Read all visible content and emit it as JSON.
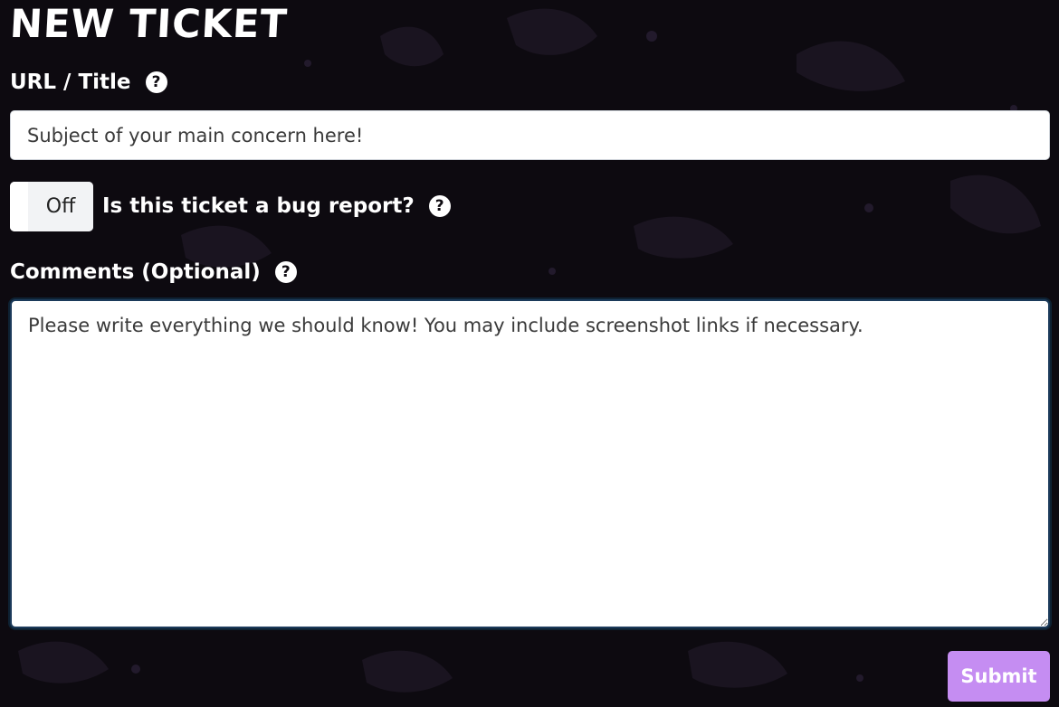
{
  "page": {
    "title": "NEW TICKET"
  },
  "form": {
    "title_field": {
      "label": "URL / Title",
      "help_icon": "?",
      "placeholder": "Subject of your main concern here!",
      "value": ""
    },
    "bug_toggle": {
      "state_label": "Off",
      "question": "Is this ticket a bug report?",
      "help_icon": "?"
    },
    "comments_field": {
      "label": "Comments (Optional)",
      "help_icon": "?",
      "placeholder": "Please write everything we should know! You may include screenshot links if necessary.",
      "value": ""
    },
    "submit_label": "Submit"
  },
  "colors": {
    "background": "#0d0a10",
    "submit_button": "#c58df2",
    "text": "#ffffff"
  }
}
